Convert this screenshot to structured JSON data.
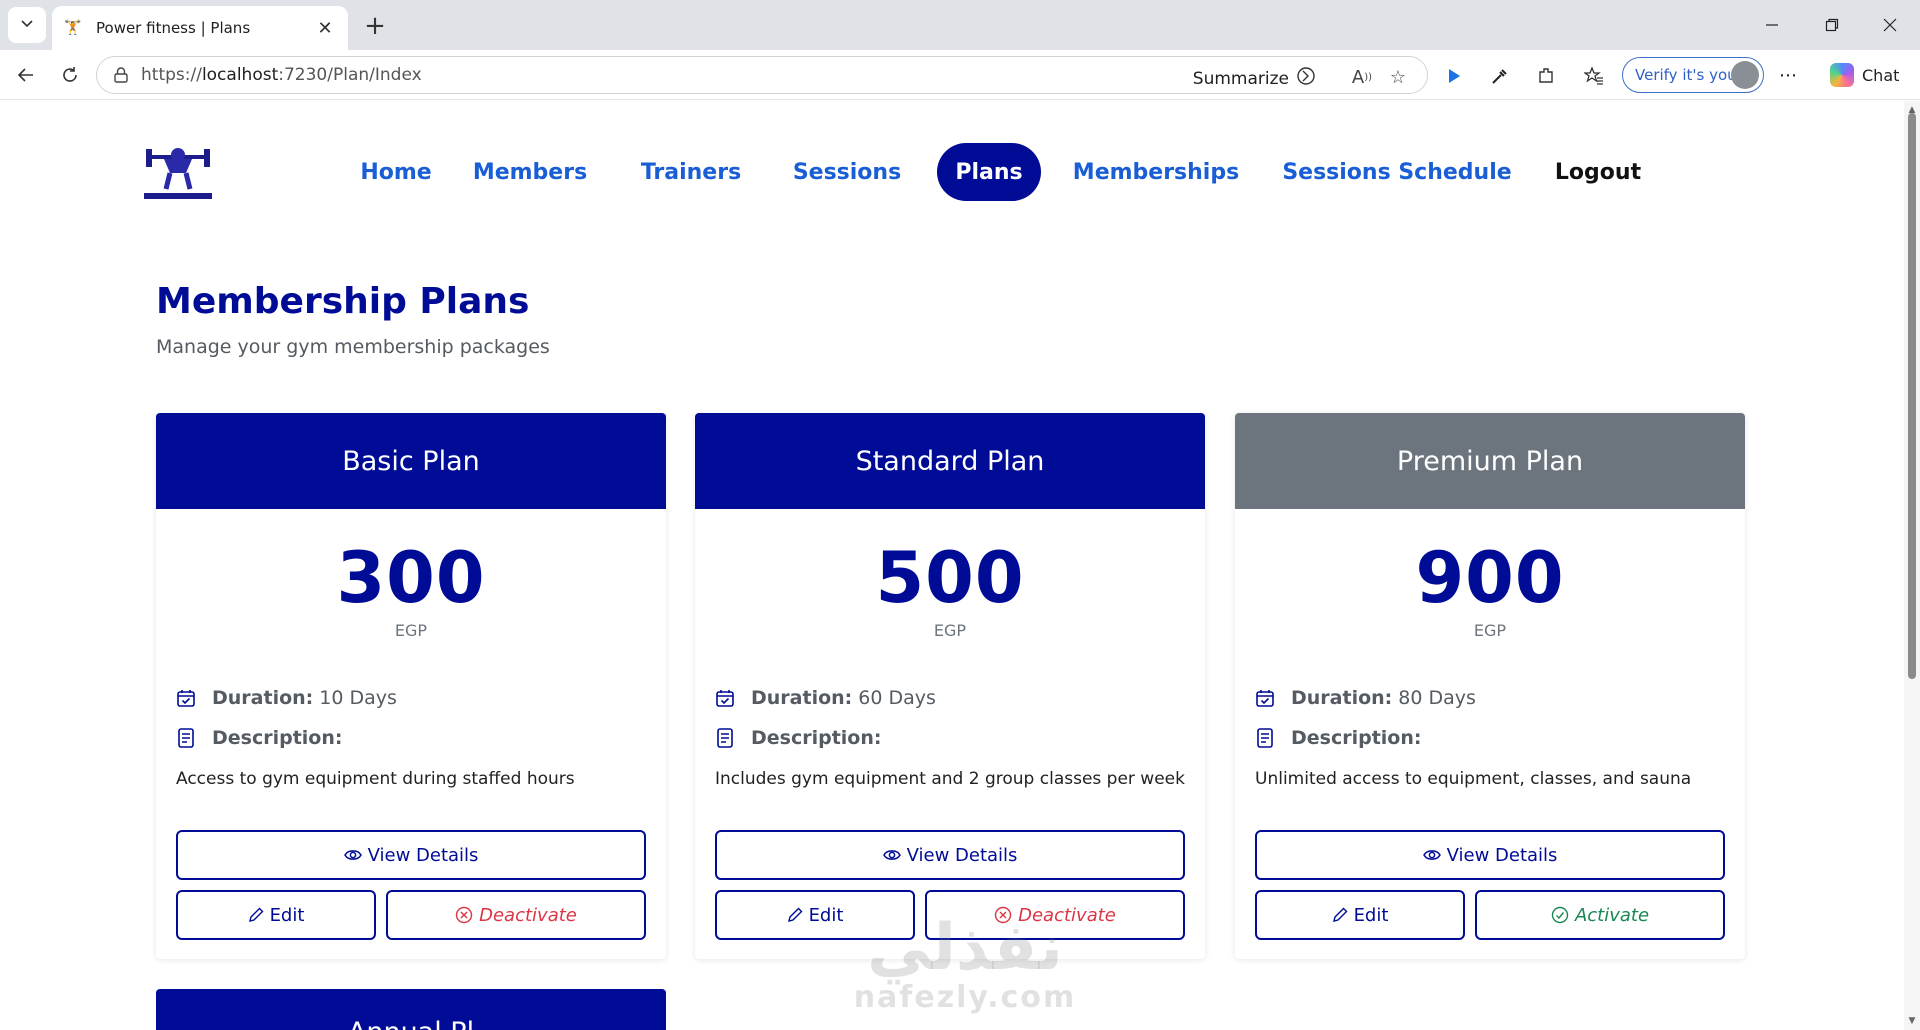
{
  "browser": {
    "tab_title": "Power fitness | Plans",
    "url_prefix": "https://",
    "url_host": "localhost",
    "url_rest": ":7230/Plan/Index",
    "summarize_label": "Summarize",
    "verify_label": "Verify it's you",
    "chat_label": "Chat"
  },
  "nav": {
    "items": [
      {
        "label": "Home"
      },
      {
        "label": "Members"
      },
      {
        "label": "Trainers"
      },
      {
        "label": "Sessions"
      },
      {
        "label": "Plans",
        "active": true
      },
      {
        "label": "Memberships"
      },
      {
        "label": "Sessions Schedule"
      },
      {
        "label": "Logout"
      }
    ]
  },
  "page": {
    "title": "Membership Plans",
    "subtitle": "Manage your gym membership packages"
  },
  "plans": [
    {
      "name": "Basic Plan",
      "price": "300",
      "currency": "EGP",
      "duration_label": "Duration:",
      "duration": "10 Days",
      "description_label": "Description:",
      "description": "Access to gym equipment during staffed hours",
      "view_label": "View Details",
      "edit_label": "Edit",
      "toggle_label": "Deactivate",
      "status": "active"
    },
    {
      "name": "Standard Plan",
      "price": "500",
      "currency": "EGP",
      "duration_label": "Duration:",
      "duration": "60 Days",
      "description_label": "Description:",
      "description": "Includes gym equipment and 2 group classes per week",
      "view_label": "View Details",
      "edit_label": "Edit",
      "toggle_label": "Deactivate",
      "status": "active"
    },
    {
      "name": "Premium Plan",
      "price": "900",
      "currency": "EGP",
      "duration_label": "Duration:",
      "duration": "80 Days",
      "description_label": "Description:",
      "description": "Unlimited access to equipment, classes, and sauna",
      "view_label": "View Details",
      "edit_label": "Edit",
      "toggle_label": "Activate",
      "status": "inactive"
    }
  ],
  "next_plan_partial": "Annual Pl",
  "watermark": {
    "arabic": "نفذلي",
    "latin": "nafezly.com"
  },
  "colors": {
    "primary": "#000c96",
    "nav_link": "#1a5ed6",
    "inactive_header": "#6c757d",
    "danger": "#dc3545",
    "success": "#198754"
  }
}
